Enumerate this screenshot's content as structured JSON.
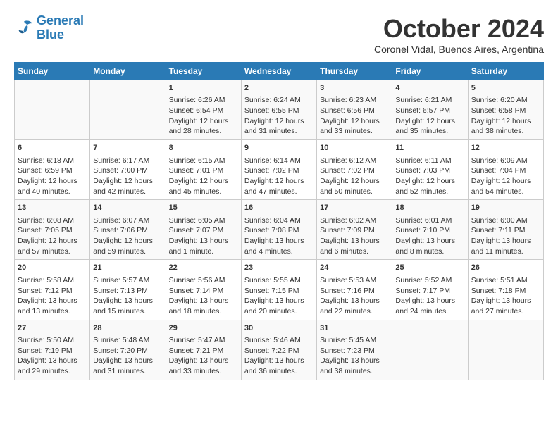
{
  "header": {
    "logo_line1": "General",
    "logo_line2": "Blue",
    "month_title": "October 2024",
    "location": "Coronel Vidal, Buenos Aires, Argentina"
  },
  "days_of_week": [
    "Sunday",
    "Monday",
    "Tuesday",
    "Wednesday",
    "Thursday",
    "Friday",
    "Saturday"
  ],
  "weeks": [
    [
      {
        "day": "",
        "info": ""
      },
      {
        "day": "",
        "info": ""
      },
      {
        "day": "1",
        "info": "Sunrise: 6:26 AM\nSunset: 6:54 PM\nDaylight: 12 hours and 28 minutes."
      },
      {
        "day": "2",
        "info": "Sunrise: 6:24 AM\nSunset: 6:55 PM\nDaylight: 12 hours and 31 minutes."
      },
      {
        "day": "3",
        "info": "Sunrise: 6:23 AM\nSunset: 6:56 PM\nDaylight: 12 hours and 33 minutes."
      },
      {
        "day": "4",
        "info": "Sunrise: 6:21 AM\nSunset: 6:57 PM\nDaylight: 12 hours and 35 minutes."
      },
      {
        "day": "5",
        "info": "Sunrise: 6:20 AM\nSunset: 6:58 PM\nDaylight: 12 hours and 38 minutes."
      }
    ],
    [
      {
        "day": "6",
        "info": "Sunrise: 6:18 AM\nSunset: 6:59 PM\nDaylight: 12 hours and 40 minutes."
      },
      {
        "day": "7",
        "info": "Sunrise: 6:17 AM\nSunset: 7:00 PM\nDaylight: 12 hours and 42 minutes."
      },
      {
        "day": "8",
        "info": "Sunrise: 6:15 AM\nSunset: 7:01 PM\nDaylight: 12 hours and 45 minutes."
      },
      {
        "day": "9",
        "info": "Sunrise: 6:14 AM\nSunset: 7:02 PM\nDaylight: 12 hours and 47 minutes."
      },
      {
        "day": "10",
        "info": "Sunrise: 6:12 AM\nSunset: 7:02 PM\nDaylight: 12 hours and 50 minutes."
      },
      {
        "day": "11",
        "info": "Sunrise: 6:11 AM\nSunset: 7:03 PM\nDaylight: 12 hours and 52 minutes."
      },
      {
        "day": "12",
        "info": "Sunrise: 6:09 AM\nSunset: 7:04 PM\nDaylight: 12 hours and 54 minutes."
      }
    ],
    [
      {
        "day": "13",
        "info": "Sunrise: 6:08 AM\nSunset: 7:05 PM\nDaylight: 12 hours and 57 minutes."
      },
      {
        "day": "14",
        "info": "Sunrise: 6:07 AM\nSunset: 7:06 PM\nDaylight: 12 hours and 59 minutes."
      },
      {
        "day": "15",
        "info": "Sunrise: 6:05 AM\nSunset: 7:07 PM\nDaylight: 13 hours and 1 minute."
      },
      {
        "day": "16",
        "info": "Sunrise: 6:04 AM\nSunset: 7:08 PM\nDaylight: 13 hours and 4 minutes."
      },
      {
        "day": "17",
        "info": "Sunrise: 6:02 AM\nSunset: 7:09 PM\nDaylight: 13 hours and 6 minutes."
      },
      {
        "day": "18",
        "info": "Sunrise: 6:01 AM\nSunset: 7:10 PM\nDaylight: 13 hours and 8 minutes."
      },
      {
        "day": "19",
        "info": "Sunrise: 6:00 AM\nSunset: 7:11 PM\nDaylight: 13 hours and 11 minutes."
      }
    ],
    [
      {
        "day": "20",
        "info": "Sunrise: 5:58 AM\nSunset: 7:12 PM\nDaylight: 13 hours and 13 minutes."
      },
      {
        "day": "21",
        "info": "Sunrise: 5:57 AM\nSunset: 7:13 PM\nDaylight: 13 hours and 15 minutes."
      },
      {
        "day": "22",
        "info": "Sunrise: 5:56 AM\nSunset: 7:14 PM\nDaylight: 13 hours and 18 minutes."
      },
      {
        "day": "23",
        "info": "Sunrise: 5:55 AM\nSunset: 7:15 PM\nDaylight: 13 hours and 20 minutes."
      },
      {
        "day": "24",
        "info": "Sunrise: 5:53 AM\nSunset: 7:16 PM\nDaylight: 13 hours and 22 minutes."
      },
      {
        "day": "25",
        "info": "Sunrise: 5:52 AM\nSunset: 7:17 PM\nDaylight: 13 hours and 24 minutes."
      },
      {
        "day": "26",
        "info": "Sunrise: 5:51 AM\nSunset: 7:18 PM\nDaylight: 13 hours and 27 minutes."
      }
    ],
    [
      {
        "day": "27",
        "info": "Sunrise: 5:50 AM\nSunset: 7:19 PM\nDaylight: 13 hours and 29 minutes."
      },
      {
        "day": "28",
        "info": "Sunrise: 5:48 AM\nSunset: 7:20 PM\nDaylight: 13 hours and 31 minutes."
      },
      {
        "day": "29",
        "info": "Sunrise: 5:47 AM\nSunset: 7:21 PM\nDaylight: 13 hours and 33 minutes."
      },
      {
        "day": "30",
        "info": "Sunrise: 5:46 AM\nSunset: 7:22 PM\nDaylight: 13 hours and 36 minutes."
      },
      {
        "day": "31",
        "info": "Sunrise: 5:45 AM\nSunset: 7:23 PM\nDaylight: 13 hours and 38 minutes."
      },
      {
        "day": "",
        "info": ""
      },
      {
        "day": "",
        "info": ""
      }
    ]
  ]
}
